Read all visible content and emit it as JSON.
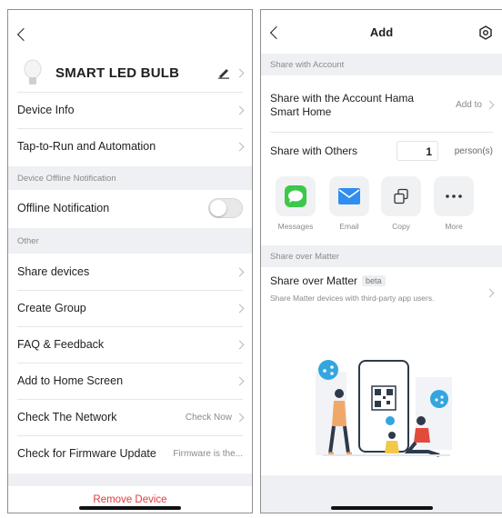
{
  "left": {
    "device_name": "SMART LED BULB",
    "items": {
      "device_info": "Device Info",
      "tap_to_run": "Tap-to-Run and Automation",
      "offline_notification": "Offline Notification",
      "share_devices": "Share devices",
      "create_group": "Create Group",
      "faq": "FAQ & Feedback",
      "add_home": "Add to Home Screen",
      "check_network": "Check The Network",
      "check_network_value": "Check Now",
      "firmware": "Check for Firmware Update",
      "firmware_value": "Firmware is the..."
    },
    "sections": {
      "offline": "Device Offline Notification",
      "other": "Other"
    },
    "offline_notification_on": false,
    "remove_device": "Remove Device",
    "colors": {
      "danger": "#e23b3b"
    }
  },
  "right": {
    "title": "Add",
    "sections": {
      "account": "Share with Account",
      "matter": "Share over Matter"
    },
    "account_share_line1": "Share with the Account Hama",
    "account_share_line2": "Smart Home",
    "add_to": "Add to",
    "share_others": "Share with Others",
    "person_count": "1",
    "person_unit": "person(s)",
    "apps": [
      {
        "label": "Messages",
        "icon": "messages-icon"
      },
      {
        "label": "Email",
        "icon": "email-icon"
      },
      {
        "label": "Copy",
        "icon": "copy-icon"
      },
      {
        "label": "More",
        "icon": "more-icon"
      }
    ],
    "matter_title": "Share over Matter",
    "matter_badge": "beta",
    "matter_desc": "Share Matter devices with third-party app users.",
    "colors": {
      "messages": "#3cc84a",
      "email": "#2f8ef0",
      "accent": "#33a6e0"
    }
  }
}
